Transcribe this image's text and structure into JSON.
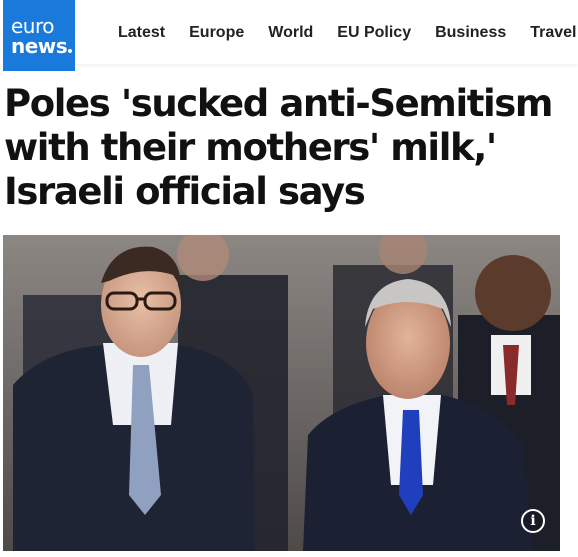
{
  "header": {
    "logo": {
      "line1": "euro",
      "line2": "news",
      "brand_color": "#1a7adb"
    },
    "nav": [
      "Latest",
      "Europe",
      "World",
      "EU Policy",
      "Business",
      "Travel"
    ]
  },
  "article": {
    "headline": "Poles 'sucked anti-Semitism with their mothers' milk,' Israeli official says",
    "photo": {
      "info_icon": "info-icon"
    }
  }
}
